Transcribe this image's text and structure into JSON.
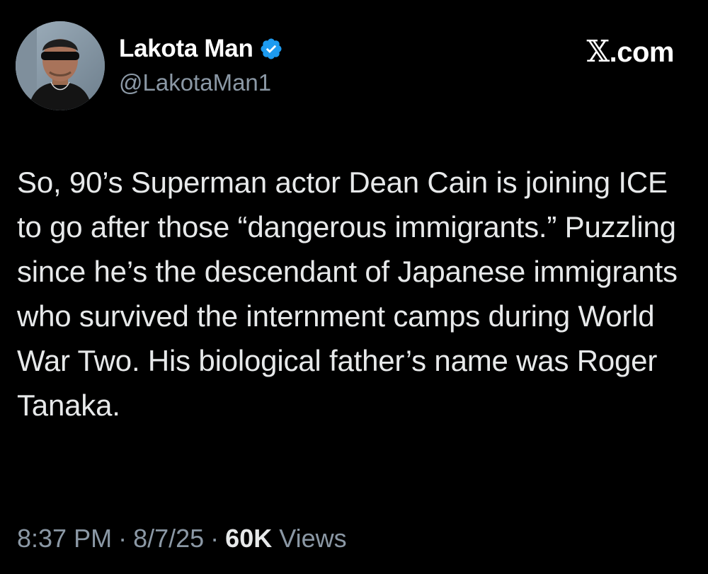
{
  "author": {
    "display_name": "Lakota Man",
    "handle": "@LakotaMan1",
    "verified": true,
    "verified_color": "#1d9bf0",
    "avatar_icon": "profile-photo"
  },
  "site_label": {
    "glyph": "𝕏",
    "text": ".com"
  },
  "tweet": {
    "text": "So, 90’s Superman actor Dean Cain is joining ICE to go after those “dangerous immigrants.” Puzzling since he’s the descendant of Japanese immigrants who survived the internment camps during World War Two. His biological father’s name was Roger Tanaka."
  },
  "meta": {
    "time": "8:37 PM",
    "date": "8/7/25",
    "separator": "·",
    "views_count": "60K",
    "views_label": "Views"
  },
  "colors": {
    "background": "#000000",
    "primary_text": "#e7e9ea",
    "secondary_text": "#8b98a5",
    "accent": "#1d9bf0"
  }
}
